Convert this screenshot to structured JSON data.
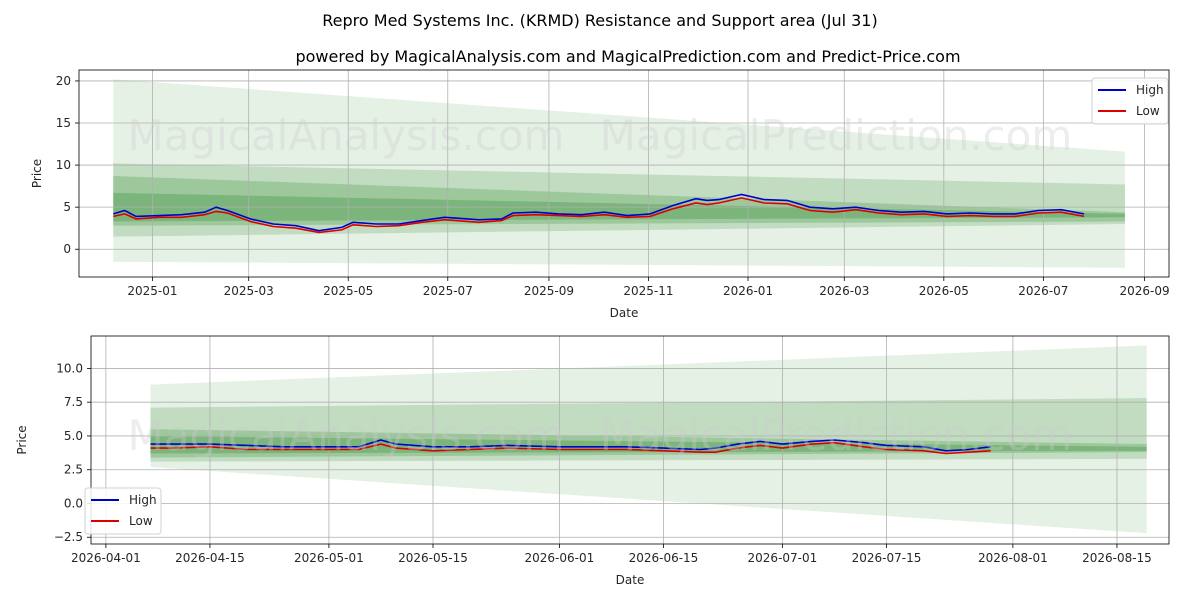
{
  "title": "Repro Med Systems Inc. (KRMD) Resistance and Support area (Jul 31)",
  "subtitle": "powered by MagicalAnalysis.com and MagicalPrediction.com and Predict-Price.com",
  "watermarks": [
    "MagicalAnalysis.com",
    "MagicalPrediction.com"
  ],
  "colors": {
    "high": "#0000cc",
    "low": "#dd0000",
    "band": "#2e8b2e",
    "grid": "#b0b0b0"
  },
  "chart_data": [
    {
      "type": "line",
      "xlabel": "Date",
      "ylabel": "Price",
      "x_ticks": [
        "2025-01",
        "2025-03",
        "2025-05",
        "2025-07",
        "2025-09",
        "2025-11",
        "2026-01",
        "2026-03",
        "2026-05",
        "2026-07",
        "2026-09"
      ],
      "y_ticks": [
        "0",
        "5",
        "10",
        "15",
        "20"
      ],
      "xlim": [
        "2024-11-17",
        "2026-09-16"
      ],
      "ylim": [
        -3.3,
        21.3
      ],
      "legend": "upper right",
      "grid": true,
      "series": [
        {
          "name": "High",
          "x": [
            "2024-12-08",
            "2024-12-15",
            "2024-12-22",
            "2025-01-05",
            "2025-01-19",
            "2025-02-02",
            "2025-02-09",
            "2025-02-16",
            "2025-03-02",
            "2025-03-16",
            "2025-03-30",
            "2025-04-13",
            "2025-04-27",
            "2025-05-04",
            "2025-05-18",
            "2025-06-01",
            "2025-06-15",
            "2025-06-29",
            "2025-07-06",
            "2025-07-20",
            "2025-08-03",
            "2025-08-10",
            "2025-08-24",
            "2025-09-07",
            "2025-09-21",
            "2025-10-05",
            "2025-10-19",
            "2025-11-02",
            "2025-11-16",
            "2025-11-30",
            "2025-12-07",
            "2025-12-14",
            "2025-12-28",
            "2026-01-11",
            "2026-01-25",
            "2026-02-08",
            "2026-02-22",
            "2026-03-08",
            "2026-03-22",
            "2026-04-05",
            "2026-04-19",
            "2026-05-03",
            "2026-05-17",
            "2026-05-31",
            "2026-06-14",
            "2026-06-28",
            "2026-07-12",
            "2026-07-26"
          ],
          "values": [
            4.2,
            4.6,
            3.9,
            4.0,
            4.1,
            4.4,
            5.0,
            4.6,
            3.6,
            3.0,
            2.8,
            2.2,
            2.6,
            3.2,
            3.0,
            3.0,
            3.4,
            3.8,
            3.7,
            3.5,
            3.6,
            4.3,
            4.4,
            4.2,
            4.1,
            4.4,
            4.0,
            4.2,
            5.2,
            6.0,
            5.8,
            5.9,
            6.5,
            5.9,
            5.8,
            5.0,
            4.8,
            5.0,
            4.6,
            4.4,
            4.5,
            4.2,
            4.3,
            4.2,
            4.2,
            4.6,
            4.7,
            4.2
          ]
        },
        {
          "name": "Low",
          "x": [
            "2024-12-08",
            "2024-12-15",
            "2024-12-22",
            "2025-01-05",
            "2025-01-19",
            "2025-02-02",
            "2025-02-09",
            "2025-02-16",
            "2025-03-02",
            "2025-03-16",
            "2025-03-30",
            "2025-04-13",
            "2025-04-27",
            "2025-05-04",
            "2025-05-18",
            "2025-06-01",
            "2025-06-15",
            "2025-06-29",
            "2025-07-06",
            "2025-07-20",
            "2025-08-03",
            "2025-08-10",
            "2025-08-24",
            "2025-09-07",
            "2025-09-21",
            "2025-10-05",
            "2025-10-19",
            "2025-11-02",
            "2025-11-16",
            "2025-11-30",
            "2025-12-07",
            "2025-12-14",
            "2025-12-28",
            "2026-01-11",
            "2026-01-25",
            "2026-02-08",
            "2026-02-22",
            "2026-03-08",
            "2026-03-22",
            "2026-04-05",
            "2026-04-19",
            "2026-05-03",
            "2026-05-17",
            "2026-05-31",
            "2026-06-14",
            "2026-06-28",
            "2026-07-12",
            "2026-07-26"
          ],
          "values": [
            3.9,
            4.2,
            3.6,
            3.8,
            3.8,
            4.1,
            4.5,
            4.3,
            3.3,
            2.7,
            2.5,
            2.0,
            2.3,
            2.9,
            2.7,
            2.8,
            3.2,
            3.5,
            3.4,
            3.2,
            3.4,
            4.0,
            4.1,
            4.0,
            3.9,
            4.1,
            3.8,
            3.9,
            4.8,
            5.5,
            5.3,
            5.5,
            6.1,
            5.5,
            5.4,
            4.6,
            4.4,
            4.7,
            4.3,
            4.1,
            4.2,
            3.9,
            4.0,
            3.9,
            3.9,
            4.3,
            4.4,
            3.9
          ]
        }
      ],
      "bands": [
        {
          "x": [
            "2024-12-08",
            "2026-08-20"
          ],
          "upper": [
            20.2,
            11.6
          ],
          "lower": [
            -1.5,
            -2.2
          ],
          "opacity": 0.12
        },
        {
          "x": [
            "2024-12-08",
            "2026-08-20"
          ],
          "upper": [
            10.2,
            7.7
          ],
          "lower": [
            1.5,
            3.0
          ],
          "opacity": 0.2
        },
        {
          "x": [
            "2024-12-08",
            "2026-08-20"
          ],
          "upper": [
            8.7,
            4.4
          ],
          "lower": [
            2.8,
            3.3
          ],
          "opacity": 0.25
        },
        {
          "x": [
            "2024-12-08",
            "2026-08-20"
          ],
          "upper": [
            6.7,
            4.2
          ],
          "lower": [
            3.3,
            3.8
          ],
          "opacity": 0.3
        }
      ]
    },
    {
      "type": "line",
      "xlabel": "Date",
      "ylabel": "Price",
      "x_ticks": [
        "2026-04-01",
        "2026-04-15",
        "2026-05-01",
        "2026-05-15",
        "2026-06-01",
        "2026-06-15",
        "2026-07-01",
        "2026-07-15",
        "2026-08-01",
        "2026-08-15"
      ],
      "y_ticks": [
        "−2.5",
        "0.0",
        "2.5",
        "5.0",
        "7.5",
        "10.0"
      ],
      "xlim": [
        "2026-03-30",
        "2026-08-22"
      ],
      "ylim": [
        -3.0,
        12.4
      ],
      "legend": "lower left",
      "grid": true,
      "series": [
        {
          "name": "High",
          "x": [
            "2026-04-07",
            "2026-04-10",
            "2026-04-15",
            "2026-04-20",
            "2026-04-25",
            "2026-05-01",
            "2026-05-05",
            "2026-05-08",
            "2026-05-10",
            "2026-05-15",
            "2026-05-20",
            "2026-05-25",
            "2026-06-01",
            "2026-06-05",
            "2026-06-10",
            "2026-06-15",
            "2026-06-20",
            "2026-06-22",
            "2026-06-25",
            "2026-06-28",
            "2026-07-01",
            "2026-07-05",
            "2026-07-08",
            "2026-07-12",
            "2026-07-15",
            "2026-07-20",
            "2026-07-23",
            "2026-07-26",
            "2026-07-29"
          ],
          "values": [
            4.4,
            4.4,
            4.4,
            4.3,
            4.2,
            4.2,
            4.2,
            4.7,
            4.4,
            4.2,
            4.2,
            4.3,
            4.2,
            4.2,
            4.2,
            4.1,
            4.0,
            4.1,
            4.4,
            4.6,
            4.4,
            4.6,
            4.7,
            4.5,
            4.3,
            4.2,
            3.9,
            4.0,
            4.2
          ]
        },
        {
          "name": "Low",
          "x": [
            "2026-04-07",
            "2026-04-10",
            "2026-04-15",
            "2026-04-20",
            "2026-04-25",
            "2026-05-01",
            "2026-05-05",
            "2026-05-08",
            "2026-05-10",
            "2026-05-15",
            "2026-05-20",
            "2026-05-25",
            "2026-06-01",
            "2026-06-05",
            "2026-06-10",
            "2026-06-15",
            "2026-06-20",
            "2026-06-22",
            "2026-06-25",
            "2026-06-28",
            "2026-07-01",
            "2026-07-05",
            "2026-07-08",
            "2026-07-12",
            "2026-07-15",
            "2026-07-20",
            "2026-07-23",
            "2026-07-26",
            "2026-07-29"
          ],
          "values": [
            4.1,
            4.1,
            4.2,
            4.0,
            4.0,
            4.0,
            4.0,
            4.4,
            4.1,
            3.9,
            4.0,
            4.1,
            4.0,
            4.0,
            4.0,
            3.9,
            3.8,
            3.8,
            4.1,
            4.3,
            4.1,
            4.4,
            4.5,
            4.2,
            4.0,
            3.9,
            3.7,
            3.8,
            3.9
          ]
        }
      ],
      "bands": [
        {
          "x": [
            "2026-04-07",
            "2026-08-19"
          ],
          "upper": [
            8.8,
            11.7
          ],
          "lower": [
            2.7,
            -2.2
          ],
          "opacity": 0.12
        },
        {
          "x": [
            "2026-04-07",
            "2026-08-19"
          ],
          "upper": [
            7.1,
            7.8
          ],
          "lower": [
            3.1,
            3.3
          ],
          "opacity": 0.2
        },
        {
          "x": [
            "2026-04-07",
            "2026-08-19"
          ],
          "upper": [
            5.5,
            4.4
          ],
          "lower": [
            3.4,
            3.8
          ],
          "opacity": 0.25
        },
        {
          "x": [
            "2026-04-07",
            "2026-08-19"
          ],
          "upper": [
            5.0,
            4.2
          ],
          "lower": [
            3.7,
            3.9
          ],
          "opacity": 0.3
        }
      ]
    }
  ]
}
